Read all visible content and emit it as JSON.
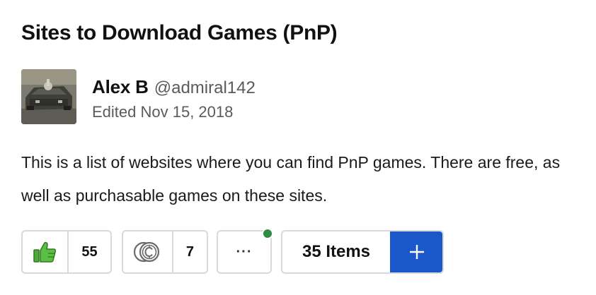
{
  "list": {
    "title": "Sites to Download Games (PnP)",
    "description": "This is a list of websites where you can find PnP games. There are free, as well as purchasable games on these sites."
  },
  "author": {
    "name": "Alex B",
    "handle": "@admiral142",
    "edited": "Edited Nov 15, 2018"
  },
  "actions": {
    "thumbs_count": "55",
    "geekgold_count": "7",
    "more_label": "···",
    "items_label": "35 Items",
    "add_label": "+"
  },
  "icons": {
    "thumbs": "thumbs-up-icon",
    "geekgold": "geekgold-coin-icon",
    "add": "plus-icon"
  },
  "colors": {
    "thumb_green": "#4caa38",
    "notify_green": "#2e8b43",
    "add_blue": "#1a57c8"
  }
}
